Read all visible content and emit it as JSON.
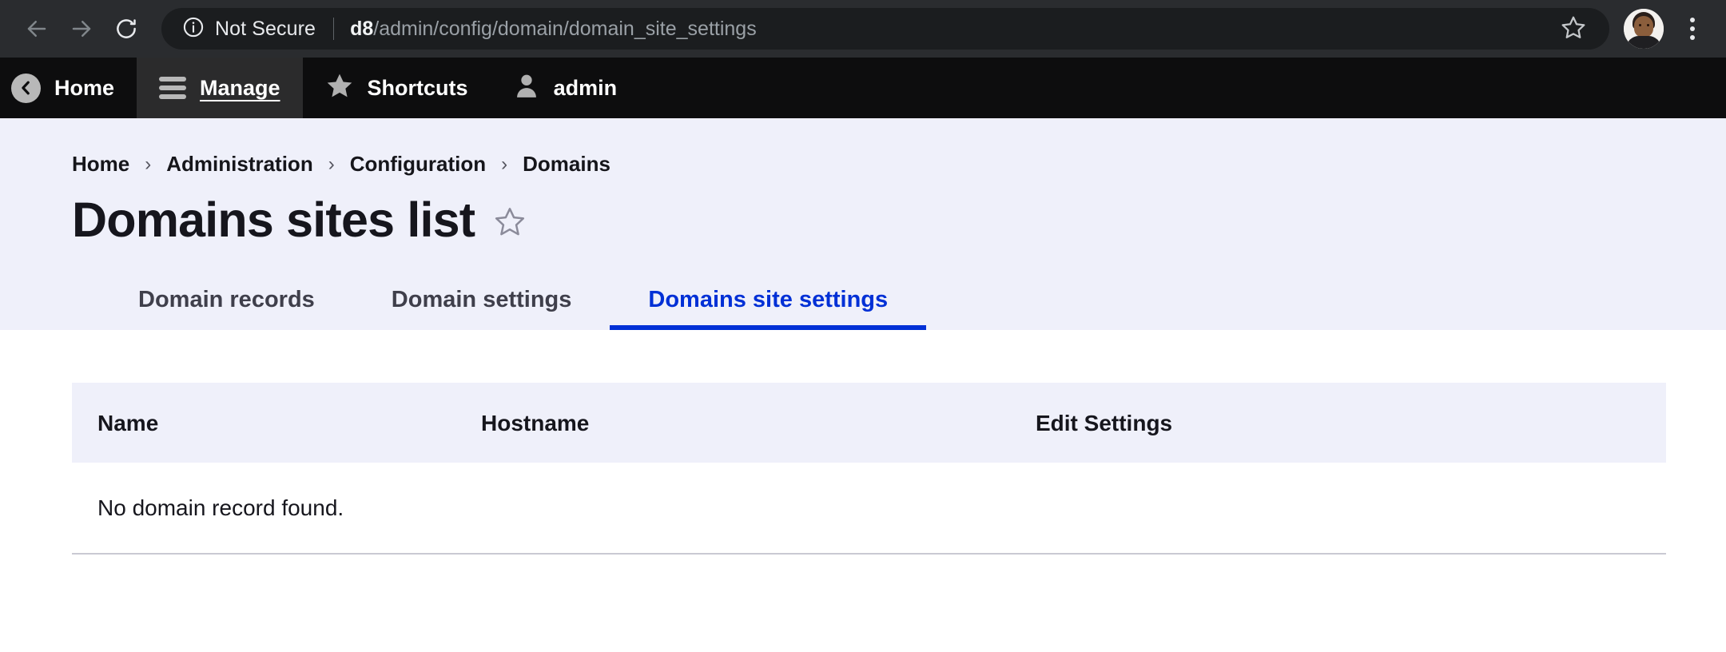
{
  "browser": {
    "back_icon": "arrow-left-icon",
    "forward_icon": "arrow-right-icon",
    "reload_icon": "reload-icon",
    "security_icon": "info-circle-icon",
    "security_label": "Not Secure",
    "url_host": "d8",
    "url_path": "/admin/config/domain/domain_site_settings",
    "url_full": "d8/admin/config/domain/domain_site_settings",
    "bookmark_icon": "star-outline-icon",
    "profile_icon": "avatar-icon",
    "menu_icon": "kebab-menu-icon",
    "colors": {
      "chrome_bg": "#2a2c2f",
      "omnibox_bg": "#1b1d1f",
      "text": "#e8eaed",
      "muted_text": "#9aa0a6"
    }
  },
  "admin_toolbar": {
    "items": [
      {
        "label": "Home",
        "icon": "home-back-circle-icon",
        "active": false
      },
      {
        "label": "Manage",
        "icon": "hamburger-icon",
        "active": true
      },
      {
        "label": "Shortcuts",
        "icon": "star-filled-icon",
        "active": false
      },
      {
        "label": "admin",
        "icon": "person-icon",
        "active": false
      }
    ],
    "colors": {
      "bg": "#0d0d0e",
      "active_bg": "#2b2b2c",
      "icon": "#b8b8b8",
      "text": "#ffffff"
    }
  },
  "breadcrumb": {
    "separator": "›",
    "items": [
      "Home",
      "Administration",
      "Configuration",
      "Domains"
    ]
  },
  "page": {
    "title": "Domains sites list",
    "favorite_icon": "star-outline-icon",
    "header_bg": "#eff0fa",
    "accent_color": "#0030d6"
  },
  "tabs": [
    {
      "label": "Domain records",
      "active": false
    },
    {
      "label": "Domain settings",
      "active": false
    },
    {
      "label": "Domains site settings",
      "active": true
    }
  ],
  "table": {
    "headers": [
      "Name",
      "Hostname",
      "Edit Settings"
    ],
    "empty_message": "No domain record found.",
    "rows": []
  }
}
